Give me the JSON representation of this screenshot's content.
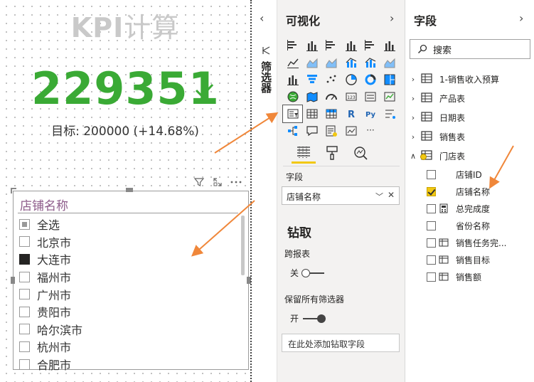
{
  "canvas": {
    "kpi": {
      "title_prefix": "KPI",
      "title_suffix": "计算",
      "value": "229351",
      "target_text": "目标: 200000 (+14.68%)",
      "status_color": "#3aaa35"
    },
    "slicer": {
      "title": "店铺名称",
      "items": [
        {
          "label": "全选",
          "state": "partial"
        },
        {
          "label": "北京市",
          "state": "unchecked"
        },
        {
          "label": "大连市",
          "state": "checked"
        },
        {
          "label": "福州市",
          "state": "unchecked"
        },
        {
          "label": "广州市",
          "state": "unchecked"
        },
        {
          "label": "贵阳市",
          "state": "unchecked"
        },
        {
          "label": "哈尔滨市",
          "state": "unchecked"
        },
        {
          "label": "杭州市",
          "state": "unchecked"
        },
        {
          "label": "合肥市",
          "state": "unchecked"
        }
      ]
    },
    "visual_header_icons": [
      "filter-icon",
      "focus-mode-icon",
      "more-options-icon"
    ]
  },
  "filter_rail": {
    "label": "筛选器",
    "collapse_icon": "chevron-left-icon"
  },
  "visualizations": {
    "title": "可视化",
    "icons": [
      "stacked-bar-chart-icon",
      "stacked-column-chart-icon",
      "clustered-bar-chart-icon",
      "clustered-column-chart-icon",
      "100-stacked-bar-chart-icon",
      "100-stacked-column-chart-icon",
      "line-chart-icon",
      "area-chart-icon",
      "stacked-area-chart-icon",
      "line-and-column-chart-icon",
      "line-and-clustered-column-chart-icon",
      "ribbon-chart-icon",
      "waterfall-chart-icon",
      "funnel-chart-icon",
      "scatter-chart-icon",
      "pie-chart-icon",
      "donut-chart-icon",
      "treemap-icon",
      "map-icon",
      "filled-map-icon",
      "gauge-icon",
      "card-icon",
      "multi-row-card-icon",
      "kpi-icon",
      "slicer-icon",
      "table-icon",
      "matrix-icon",
      "r-script-icon",
      "python-visual-icon",
      "key-influencers-icon",
      "decomposition-tree-icon",
      "qa-icon",
      "smart-narrative-icon",
      "paginated-report-icon",
      "more-visuals-icon"
    ],
    "selected_icon": "slicer-icon",
    "r_glyph": "R",
    "py_glyph": "Py",
    "more_glyph": "···",
    "tabs": [
      "fields-tab-icon",
      "format-paint-icon",
      "analytics-icon"
    ],
    "fields_label": "字段",
    "field_well_value": "店铺名称",
    "drill_title": "钻取",
    "cross_report_label": "跨报表",
    "cross_report_state": "关",
    "keep_filters_label": "保留所有筛选器",
    "keep_filters_state": "开",
    "drill_drop_placeholder": "在此处添加钻取字段"
  },
  "fields": {
    "title": "字段",
    "search_placeholder": "搜索",
    "tables": [
      {
        "name": "1-销售收入预算",
        "expanded": false
      },
      {
        "name": "产品表",
        "expanded": false
      },
      {
        "name": "日期表",
        "expanded": false
      },
      {
        "name": "销售表",
        "expanded": false
      },
      {
        "name": "门店表",
        "expanded": true
      }
    ],
    "store_fields": [
      {
        "name": "店铺ID",
        "checked": false,
        "icon": "none"
      },
      {
        "name": "店铺名称",
        "checked": true,
        "icon": "none"
      },
      {
        "name": "总完成度",
        "checked": false,
        "icon": "calculator-icon"
      },
      {
        "name": "省份名称",
        "checked": false,
        "icon": "none"
      },
      {
        "name": "销售任务完...",
        "checked": false,
        "icon": "table-field-icon"
      },
      {
        "name": "销售目标",
        "checked": false,
        "icon": "table-field-icon"
      },
      {
        "name": "销售额",
        "checked": false,
        "icon": "table-field-icon"
      }
    ]
  },
  "colors": {
    "accent_yellow": "#f2c811",
    "annotation_arrow": "#f0873a",
    "slicer_title": "#8d5b8a"
  }
}
